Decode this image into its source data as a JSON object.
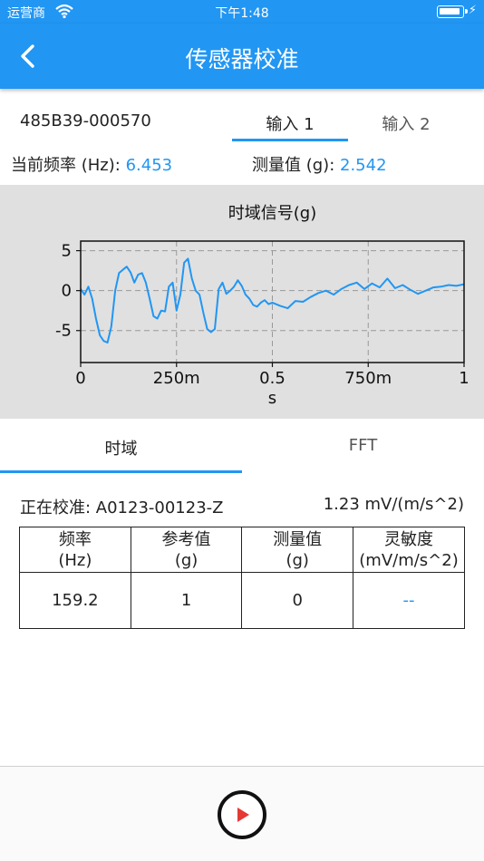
{
  "status_bar": {
    "carrier": "运营商",
    "time": "下午1:48",
    "battery_level": 0.9
  },
  "app_bar": {
    "title": "传感器校准"
  },
  "device": {
    "id": "485B39-000570"
  },
  "input_tabs": [
    {
      "label": "输入 1",
      "selected": true
    },
    {
      "label": "输入 2",
      "selected": false
    }
  ],
  "readings": {
    "frequency_label": "当前频率 (Hz):",
    "frequency_value": "6.453",
    "measured_label": "测量值 (g):",
    "measured_value": "2.542"
  },
  "chart_data": {
    "type": "line",
    "title": "时域信号(g)",
    "xlabel": "s",
    "ylabel": "",
    "xlim": [
      0,
      1
    ],
    "ylim": [
      -9,
      6.2
    ],
    "x_tick_values": [
      0,
      0.25,
      0.5,
      0.75,
      1
    ],
    "x_tick_labels": [
      "0",
      "250m",
      "0.5",
      "750m",
      "1"
    ],
    "y_tick_values": [
      5,
      0,
      -5
    ],
    "y_tick_labels": [
      "5",
      "0",
      "-5"
    ],
    "grid": true,
    "colors": {
      "line": "#2196f3",
      "grid": "#999999",
      "background": "#e0e0e0"
    },
    "series": [
      {
        "x": [
          0,
          0.01,
          0.02,
          0.03,
          0.04,
          0.05,
          0.06,
          0.07,
          0.08,
          0.09,
          0.1,
          0.11,
          0.12,
          0.13,
          0.14,
          0.15,
          0.16,
          0.17,
          0.18,
          0.19,
          0.2,
          0.21,
          0.22,
          0.23,
          0.24,
          0.25,
          0.26,
          0.27,
          0.28,
          0.29,
          0.3,
          0.31,
          0.32,
          0.33,
          0.34,
          0.35,
          0.36,
          0.37,
          0.38,
          0.39,
          0.4,
          0.41,
          0.42,
          0.43,
          0.44,
          0.45,
          0.46,
          0.47,
          0.48,
          0.49,
          0.5,
          0.52,
          0.54,
          0.56,
          0.58,
          0.6,
          0.62,
          0.64,
          0.66,
          0.68,
          0.7,
          0.72,
          0.74,
          0.76,
          0.78,
          0.8,
          0.82,
          0.84,
          0.86,
          0.88,
          0.9,
          0.92,
          0.94,
          0.96,
          0.98,
          1.0
        ],
        "y": [
          0.2,
          -0.5,
          0.5,
          -1.0,
          -3.5,
          -5.6,
          -6.3,
          -6.5,
          -4.5,
          0.0,
          2.2,
          2.6,
          3.0,
          2.3,
          1.0,
          2.0,
          2.2,
          1.0,
          -1.0,
          -3.2,
          -3.5,
          -2.5,
          -2.6,
          0.5,
          1.0,
          -2.5,
          -0.5,
          3.5,
          4.0,
          1.5,
          0.0,
          -0.5,
          -2.8,
          -4.8,
          -5.2,
          -4.8,
          0.2,
          1.0,
          -0.4,
          0.0,
          0.5,
          1.3,
          0.6,
          -0.5,
          -1.0,
          -1.8,
          -2.0,
          -1.5,
          -1.2,
          -1.7,
          -1.5,
          -1.9,
          -2.2,
          -1.3,
          -1.4,
          -0.8,
          -0.3,
          0.0,
          -0.5,
          0.2,
          0.7,
          1.0,
          0.2,
          0.9,
          0.4,
          1.5,
          0.3,
          0.7,
          0.1,
          -0.4,
          0.0,
          0.4,
          0.5,
          0.7,
          0.6,
          0.8
        ]
      }
    ]
  },
  "view_tabs": [
    {
      "label": "时域",
      "selected": true
    },
    {
      "label": "FFT",
      "selected": false
    }
  ],
  "calibration": {
    "label": "正在校准: A0123-00123-Z",
    "sensitivity": "1.23 mV/(m/s^2)"
  },
  "table": {
    "headers": [
      {
        "line1": "频率",
        "line2": "(Hz)"
      },
      {
        "line1": "参考值",
        "line2": "(g)"
      },
      {
        "line1": "测量值",
        "line2": "(g)"
      },
      {
        "line1": "灵敏度",
        "line2": "(mV/m/s^2)"
      }
    ],
    "rows": [
      [
        "159.2",
        "1",
        "0",
        "--"
      ]
    ]
  },
  "icons": {
    "back": "back-arrow-icon",
    "play": "play-icon",
    "wifi": "wifi-icon",
    "battery": "battery-icon",
    "charge": "charging-bolt-icon"
  }
}
